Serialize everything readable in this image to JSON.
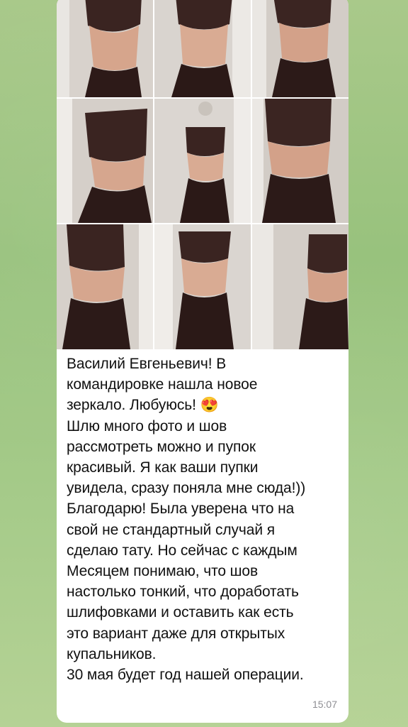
{
  "chat": {
    "background_color": "#9fc783",
    "message": {
      "lines": [
        "Василий Евгеньевич! В",
        "командировке нашла новое",
        "зеркало. Любуюсь! 😍",
        "Шлю много фото и шов",
        "рассмотреть можно и пупок",
        "красивый. Я как ваши пупки",
        "увидела, сразу поняла мне сюда!))",
        "Благодарю! Была уверена что на",
        "свой не стандартный случай я",
        "сделаю тату. Но сейчас с каждым",
        "Месяцем понимаю, что шов",
        "настолько тонкий, что доработать",
        "шлифовками и оставить как есть",
        "это вариант даже для открытых",
        "купальников.",
        "30 мая будет год нашей операции."
      ],
      "time": "15:07"
    },
    "photos_count": 9
  }
}
